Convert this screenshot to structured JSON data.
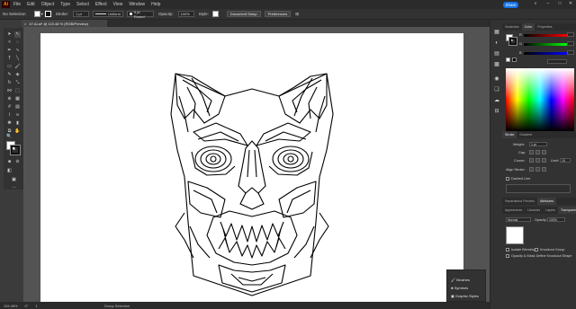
{
  "menubar": {
    "logo": "Ai",
    "items": [
      "File",
      "Edit",
      "Object",
      "Type",
      "Select",
      "Effect",
      "View",
      "Window",
      "Help"
    ],
    "share_label": "Share",
    "window_controls": [
      "minimize-icon",
      "maximize-icon",
      "close-icon"
    ]
  },
  "controlbar": {
    "selection_label": "No Selection",
    "stroke_label": "Stroke:",
    "stroke_value": "1 pt",
    "profile_value": "Uniform",
    "brush_value": "5 pt. Round",
    "opacity_label": "Opacity:",
    "opacity_value": "100%",
    "style_label": "Style:",
    "doc_setup_label": "Document Setup",
    "preferences_label": "Preferences"
  },
  "document": {
    "tab_title": "47.Ai.ai* @ 119.48 % (RGB/Preview)"
  },
  "statusbar": {
    "zoom": "119.48%",
    "rotation": "0°",
    "artboard": "1",
    "tool_status": "Group Selection"
  },
  "color_panel": {
    "tabs": [
      "Swatches",
      "Color",
      "Properties"
    ],
    "active_tab": "Color",
    "sliders": [
      {
        "letter": "R",
        "value": "",
        "gradient": "linear-gradient(to right,#000,#f00)"
      },
      {
        "letter": "G",
        "value": "",
        "gradient": "linear-gradient(to right,#000,#0f0)"
      },
      {
        "letter": "B",
        "value": "",
        "gradient": "linear-gradient(to right,#000,#00f)"
      }
    ],
    "hex_value": ""
  },
  "stroke_panel": {
    "tabs": [
      "Stroke",
      "Gradient"
    ],
    "weight_label": "Weight:",
    "weight_value": "1 pt",
    "cap_label": "Cap:",
    "corner_label": "Corner:",
    "limit_label": "Limit:",
    "limit_value": "10",
    "align_label": "Align Stroke:",
    "dashed_label": "Dashed Line"
  },
  "transparency_panel": {
    "tabs_top": [
      "Separations Preview",
      "Attributes"
    ],
    "tabs_bottom": [
      "Appearance",
      "Libraries",
      "Layers",
      "Transparency"
    ],
    "blend_mode": "Normal",
    "opacity_label": "Opacity:",
    "opacity_value": "100%",
    "isolate_label": "Isolate Blending",
    "knockout_label": "Knockout Group",
    "mask_label": "Opacity & Mask Define Knockout Shape"
  },
  "floating_panel": {
    "items": [
      "Brushes",
      "Symbols",
      "Graphic Styles"
    ]
  },
  "colors": {
    "accent": "#1473e6",
    "ui_dark": "#323232",
    "canvas": "#535353",
    "artboard": "#ffffff"
  }
}
